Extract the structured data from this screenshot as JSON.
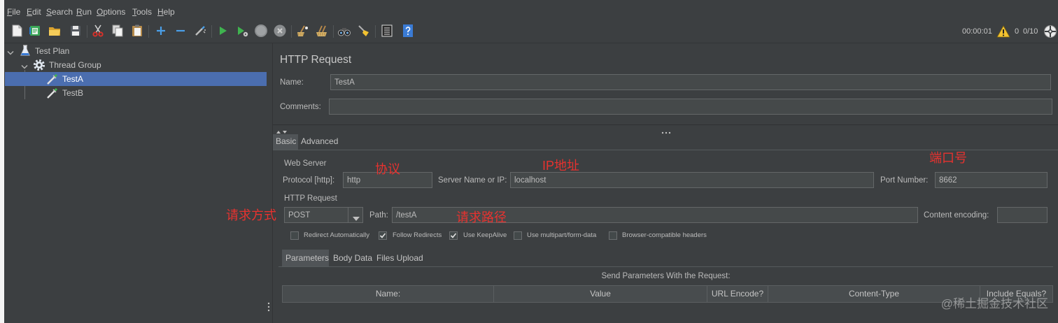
{
  "theme": {
    "background": "#3c3f41",
    "text": "#bbbbbb",
    "input_background": "#45494a",
    "selection": "#4b6eaf",
    "annotation": "#e8322f"
  },
  "menu": {
    "items": [
      {
        "label": "File"
      },
      {
        "label": "Edit"
      },
      {
        "label": "Search"
      },
      {
        "label": "Run"
      },
      {
        "label": "Options"
      },
      {
        "label": "Tools"
      },
      {
        "label": "Help"
      }
    ]
  },
  "toolbar": {
    "icons": [
      "new-icon",
      "templates-icon",
      "open-icon",
      "save-icon",
      "cut-icon",
      "copy-icon",
      "paste-icon",
      "expand-icon",
      "collapse-icon",
      "toggle-icon",
      "start-icon",
      "start-no-pauses-icon",
      "stop-icon",
      "shutdown-icon",
      "clear-icon",
      "clear-all-icon",
      "search-icon",
      "reset-search-icon",
      "function-helper-icon",
      "help-icon"
    ],
    "status": {
      "elapsed_time": "00:00:01",
      "error_count": "0",
      "active_threads": "0/10",
      "warning_icon": "warning-icon",
      "log_icon": "log-viewer-icon"
    }
  },
  "tree": {
    "items": [
      {
        "label": "Test Plan",
        "icon": "test-plan-icon"
      },
      {
        "label": "Thread Group",
        "icon": "thread-group-icon"
      },
      {
        "label": "TestA",
        "icon": "sampler-icon",
        "selected": true
      },
      {
        "label": "TestB",
        "icon": "sampler-icon",
        "selected": false
      }
    ]
  },
  "panel": {
    "title": "HTTP Request",
    "name_label": "Name:",
    "name_value": "TestA",
    "comments_label": "Comments:",
    "comments_value": "",
    "tabs": [
      {
        "label": "Basic",
        "selected": true
      },
      {
        "label": "Advanced",
        "selected": false
      }
    ]
  },
  "web_server": {
    "group_label": "Web Server",
    "protocol_label": "Protocol [http]:",
    "protocol_value": "http",
    "server_label": "Server Name or IP:",
    "server_value": "localhost",
    "port_label": "Port Number:",
    "port_value": "8662"
  },
  "http_request": {
    "group_label": "HTTP Request",
    "method": "POST",
    "path_label": "Path:",
    "path_value": "/testA",
    "encoding_label": "Content encoding:",
    "encoding_value": "",
    "options": [
      {
        "label": "Redirect Automatically",
        "checked": false
      },
      {
        "label": "Follow Redirects",
        "checked": true
      },
      {
        "label": "Use KeepAlive",
        "checked": true
      },
      {
        "label": "Use multipart/form-data",
        "checked": false
      },
      {
        "label": "Browser-compatible headers",
        "checked": false
      }
    ]
  },
  "parameters": {
    "tabs": [
      {
        "label": "Parameters",
        "selected": true
      },
      {
        "label": "Body Data",
        "selected": false
      },
      {
        "label": "Files Upload",
        "selected": false
      }
    ],
    "caption": "Send Parameters With the Request:",
    "columns": [
      "Name:",
      "Value",
      "URL Encode?",
      "Content-Type",
      "Include Equals?"
    ],
    "rows": []
  },
  "annotations": {
    "protocol": "协议",
    "ip": "IP地址",
    "port": "端口号",
    "method": "请求方式",
    "path": "请求路径"
  },
  "watermark": "@稀土掘金技术社区"
}
